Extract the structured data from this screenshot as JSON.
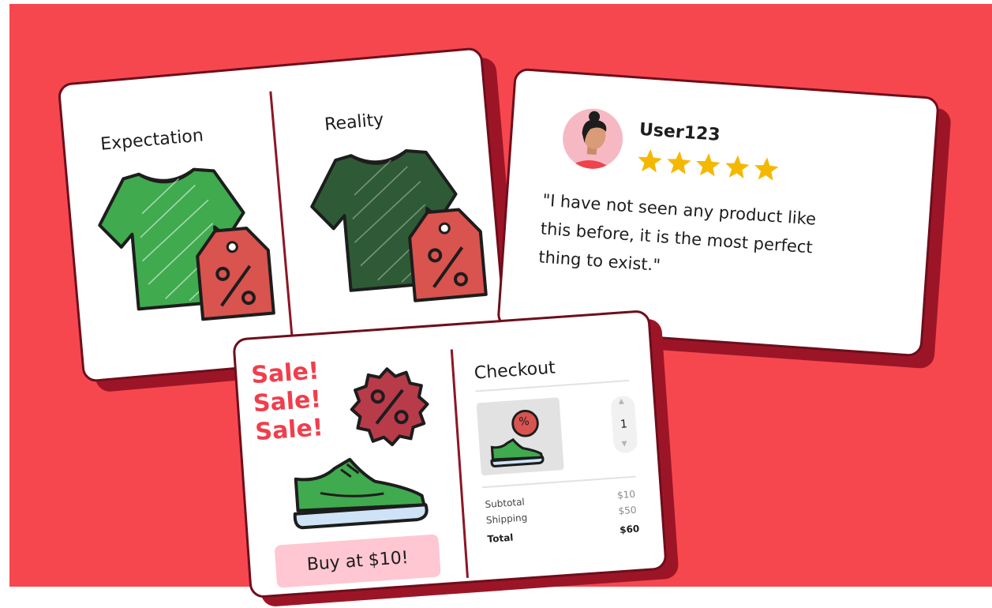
{
  "comparison_card": {
    "expectation_label": "Expectation",
    "reality_label": "Reality",
    "tag_symbol": "%"
  },
  "review_card": {
    "username": "User123",
    "rating": 5,
    "rating_max": 5,
    "star_color": "#f5b800",
    "quote_line1": "\"I have not seen any product like",
    "quote_line2": "this before, it is the most perfect",
    "quote_line3": "thing to exist.\""
  },
  "sale_card": {
    "sale_line1": "Sale!",
    "sale_line2": "Sale!",
    "sale_line3": "Sale!",
    "badge_symbol": "%",
    "buy_button_label": "Buy at $10!",
    "checkout_title": "Checkout",
    "quantity": "1",
    "item_badge_symbol": "%",
    "subtotal_label": "Subtotal",
    "subtotal_value": "$10",
    "shipping_label": "Shipping",
    "shipping_value": "$50",
    "total_label": "Total",
    "total_value": "$60"
  },
  "colors": {
    "background": "#f6474f",
    "card_shadow": "#9c1527",
    "shirt_green": "#3faa4e",
    "shirt_dark_green": "#2f5a36",
    "tag_red": "#d9534f",
    "sale_red": "#f03e4c",
    "button_pink": "#ffc7d1"
  }
}
